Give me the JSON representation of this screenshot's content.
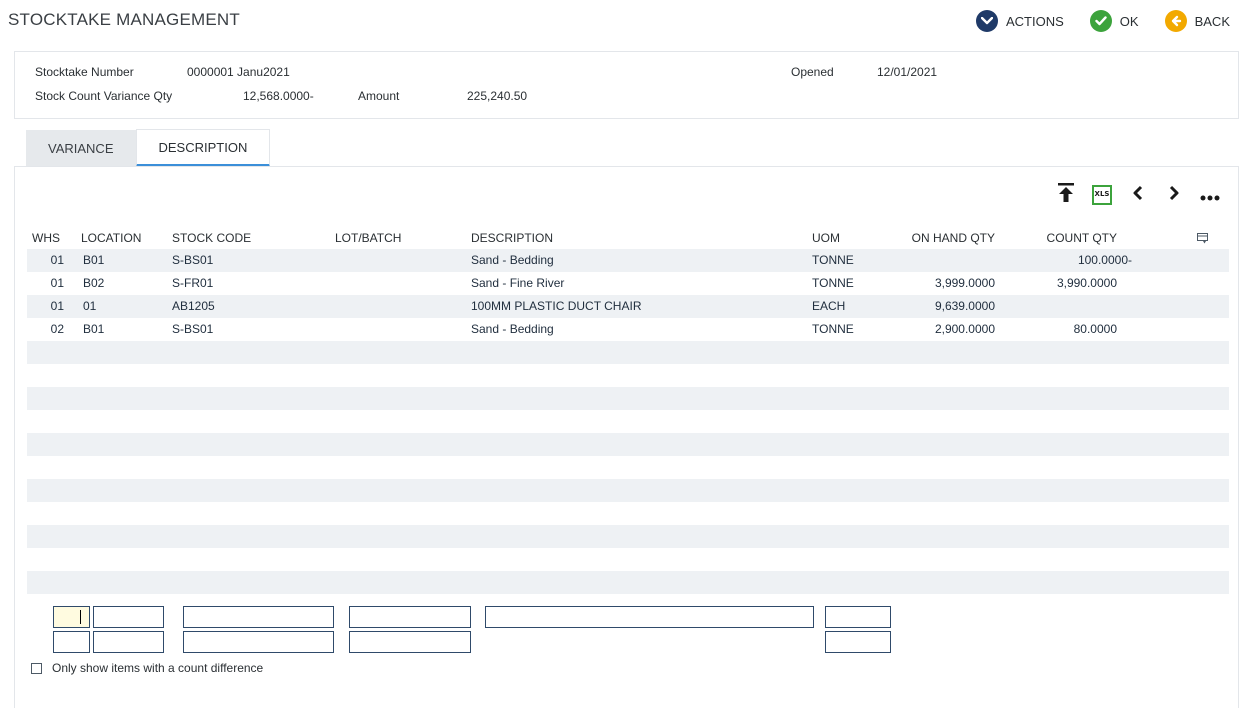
{
  "app": {
    "title": "STOCKTAKE MANAGEMENT"
  },
  "top_actions": [
    {
      "label": "ACTIONS",
      "icon": "chevron-down-icon",
      "color": "#1f3a68"
    },
    {
      "label": "OK",
      "icon": "check-icon",
      "color": "#3ca33c"
    },
    {
      "label": "BACK",
      "icon": "arrow-left-icon",
      "color": "#f2a900"
    }
  ],
  "header": {
    "stocktake_number_label": "Stocktake Number",
    "stocktake_number_value": "0000001 Janu2021",
    "opened_label": "Opened",
    "opened_value": "12/01/2021",
    "variance_qty_label": "Stock Count Variance Qty",
    "variance_qty_value": "12,568.0000-",
    "amount_label": "Amount",
    "amount_value": "225,240.50"
  },
  "tabs": [
    {
      "label": "VARIANCE",
      "active": false
    },
    {
      "label": "DESCRIPTION",
      "active": true
    }
  ],
  "toolbar": {
    "icons": [
      "move-to-top-icon",
      "xls-export-icon",
      "previous-icon",
      "next-icon",
      "more-icon"
    ],
    "xls_label": "XLS"
  },
  "grid": {
    "columns": [
      "WHS",
      "LOCATION",
      "STOCK CODE",
      "LOT/BATCH",
      "DESCRIPTION",
      "UOM",
      "ON HAND QTY",
      "COUNT QTY"
    ],
    "rows": [
      [
        "01",
        "B01",
        "S-BS01",
        "",
        "Sand - Bedding",
        "TONNE",
        "",
        "100.0000-"
      ],
      [
        "01",
        "B02",
        "S-FR01",
        "",
        "Sand - Fine River",
        "TONNE",
        "3,999.0000",
        "3,990.0000"
      ],
      [
        "01",
        "01",
        "AB1205",
        "",
        "100MM PLASTIC DUCT CHAIR",
        "EACH",
        "9,639.0000",
        ""
      ],
      [
        "02",
        "B01",
        "S-BS01",
        "",
        "Sand - Bedding",
        "TONNE",
        "2,900.0000",
        "80.0000"
      ]
    ],
    "empty_row_count": 11
  },
  "filter": {
    "checkbox_label": "Only show items with a count difference",
    "checked": false
  },
  "colors": {
    "accent": "#3b8fd9",
    "row_stripe": "#eef1f4",
    "filter_border": "#2f4a6a"
  }
}
